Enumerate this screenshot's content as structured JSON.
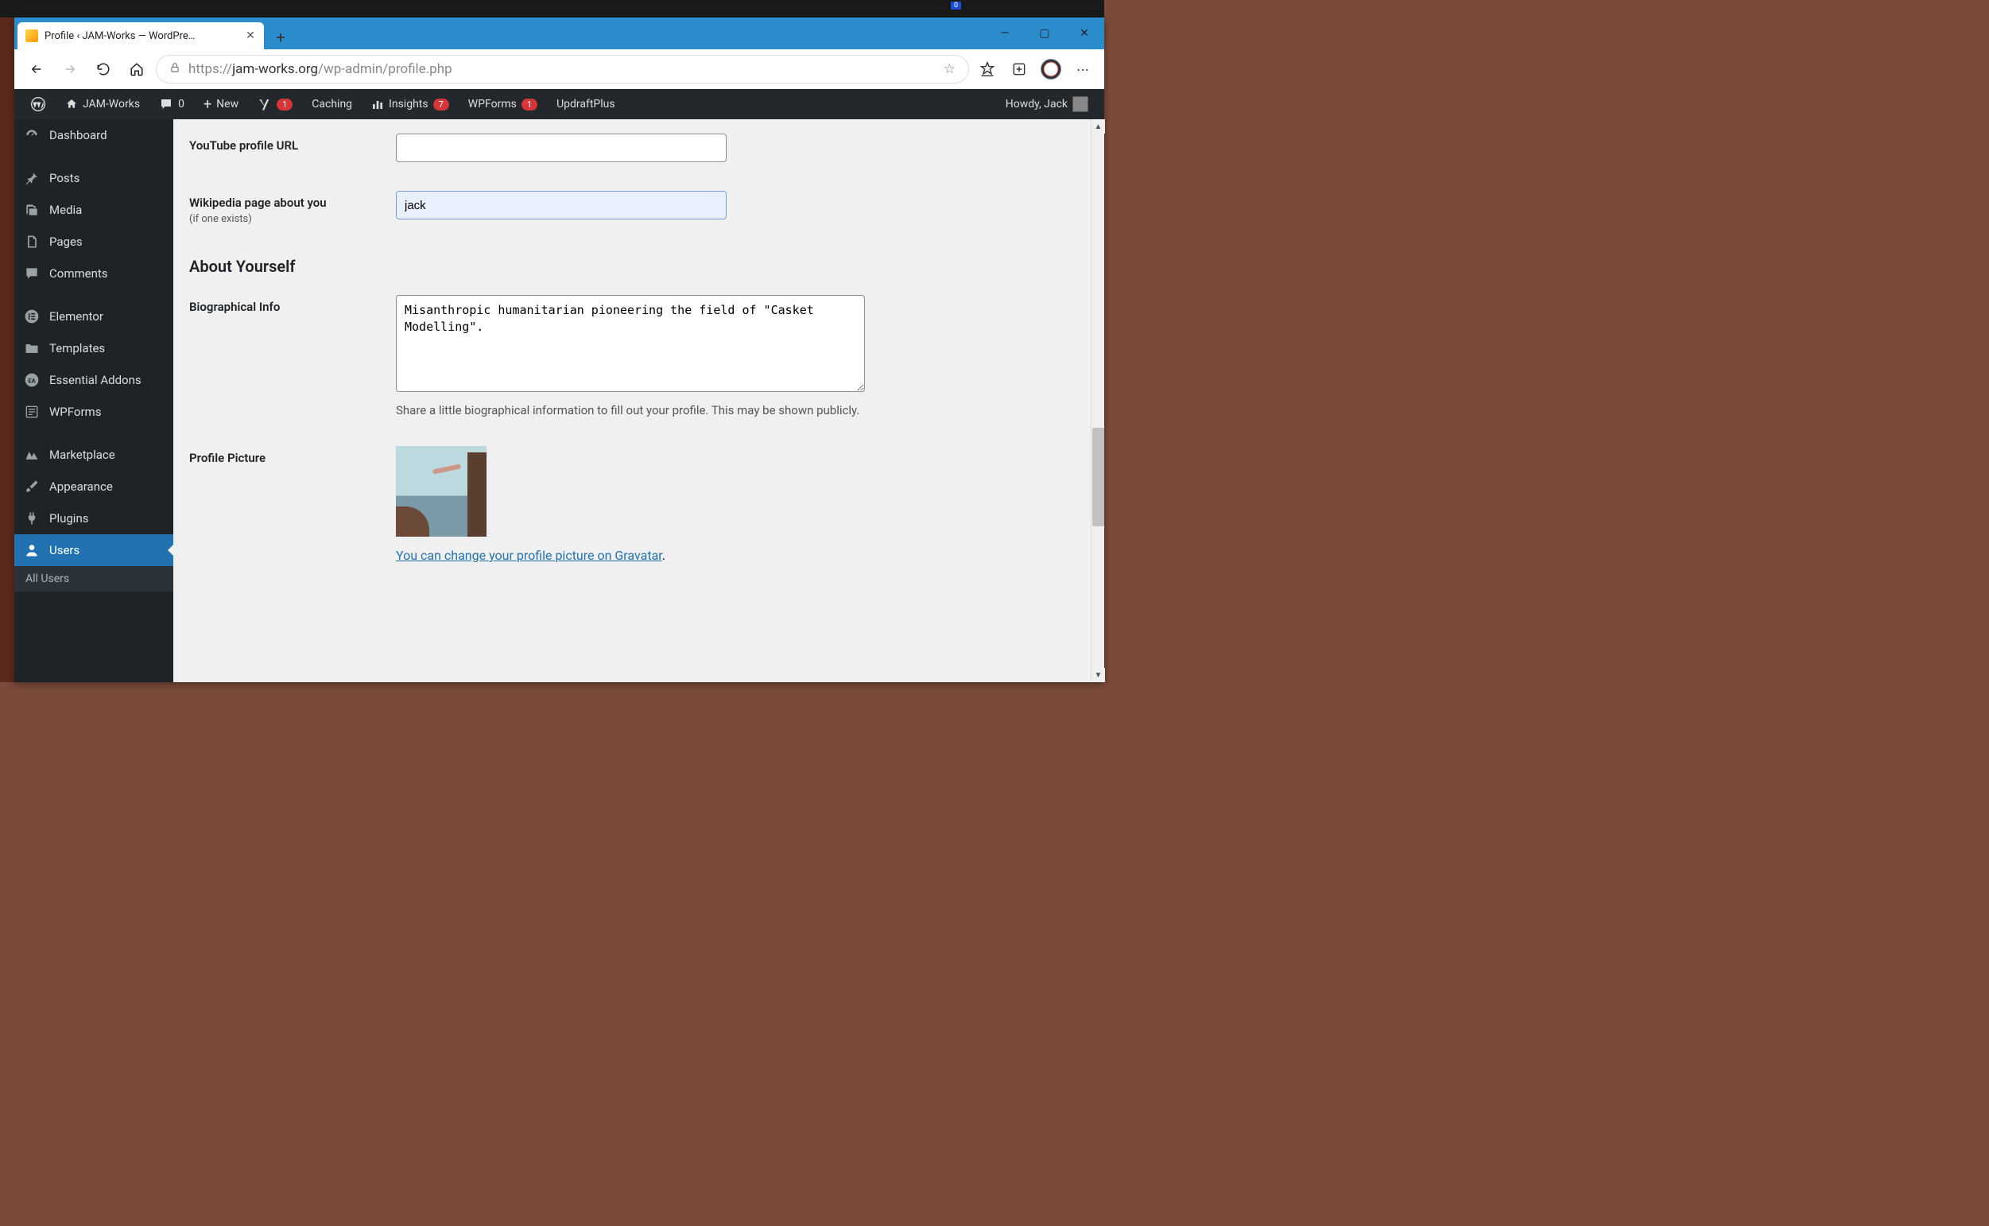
{
  "taskbar": {
    "notif_count": "0"
  },
  "browser": {
    "tab_title": "Profile ‹ JAM-Works — WordPre…",
    "url_scheme": "https://",
    "url_host": "jam-works.org",
    "url_path": "/wp-admin/profile.php"
  },
  "adminbar": {
    "site_name": "JAM-Works",
    "comments_count": "0",
    "new_label": "New",
    "yoast_badge": "1",
    "caching_label": "Caching",
    "insights_label": "Insights",
    "insights_badge": "7",
    "wpforms_label": "WPForms",
    "wpforms_badge": "1",
    "updraft_label": "UpdraftPlus",
    "howdy": "Howdy, Jack"
  },
  "sidebar": {
    "items": [
      {
        "label": "Dashboard",
        "icon": "dash"
      },
      {
        "label": "Posts",
        "icon": "pin"
      },
      {
        "label": "Media",
        "icon": "media"
      },
      {
        "label": "Pages",
        "icon": "page"
      },
      {
        "label": "Comments",
        "icon": "comment"
      },
      {
        "label": "Elementor",
        "icon": "elementor"
      },
      {
        "label": "Templates",
        "icon": "folder"
      },
      {
        "label": "Essential Addons",
        "icon": "ea"
      },
      {
        "label": "WPForms",
        "icon": "wpforms"
      },
      {
        "label": "Marketplace",
        "icon": "market"
      },
      {
        "label": "Appearance",
        "icon": "brush"
      },
      {
        "label": "Plugins",
        "icon": "plug"
      },
      {
        "label": "Users",
        "icon": "user"
      }
    ],
    "submenu_allusers": "All Users"
  },
  "form": {
    "youtube_label": "YouTube profile URL",
    "youtube_value": "",
    "wikipedia_label": "Wikipedia page about you",
    "wikipedia_desc": "(if one exists)",
    "wikipedia_value": "jack",
    "about_heading": "About Yourself",
    "bio_label": "Biographical Info",
    "bio_value": "Misanthropic humanitarian pioneering the field of \"Casket Modelling\".",
    "bio_help": "Share a little biographical information to fill out your profile. This may be shown publicly.",
    "picture_label": "Profile Picture",
    "gravatar_link_text": "You can change your profile picture on Gravatar",
    "gravatar_link_suffix": "."
  }
}
